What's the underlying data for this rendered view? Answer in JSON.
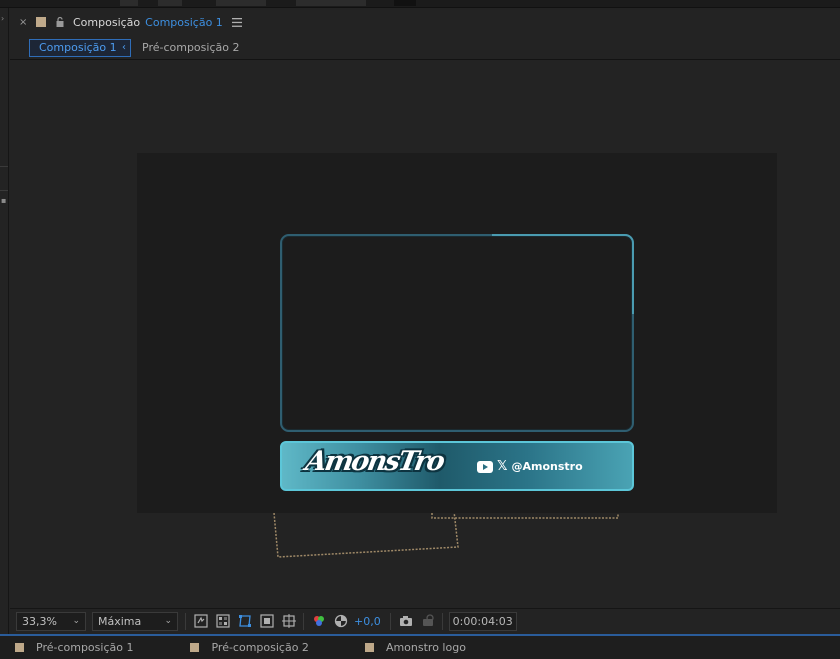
{
  "panel": {
    "title": "Composição",
    "comp_name": "Composição 1"
  },
  "nav": {
    "active": "Composição 1",
    "next": "Pré-composição 2"
  },
  "canvas": {
    "logo_text": "AmonsTro",
    "handle": "@Amonstro"
  },
  "toolbar": {
    "zoom": "33,3%",
    "resolution": "Máxima",
    "exposure": "+0,0",
    "timecode": "0:00:04:03"
  },
  "tabs": [
    {
      "label": "Pré-composição 1"
    },
    {
      "label": "Pré-composição 2"
    },
    {
      "label": "Amonstro logo"
    }
  ],
  "colors": {
    "accent": "#3d8fe0",
    "comp_swatch": "#bfa98a",
    "banner_border": "#5cc6d8"
  },
  "icons": {
    "close": "close-icon",
    "lock": "lock-icon",
    "menu": "hamburger-menu-icon",
    "youtube": "youtube-icon",
    "x": "x-logo-icon"
  }
}
